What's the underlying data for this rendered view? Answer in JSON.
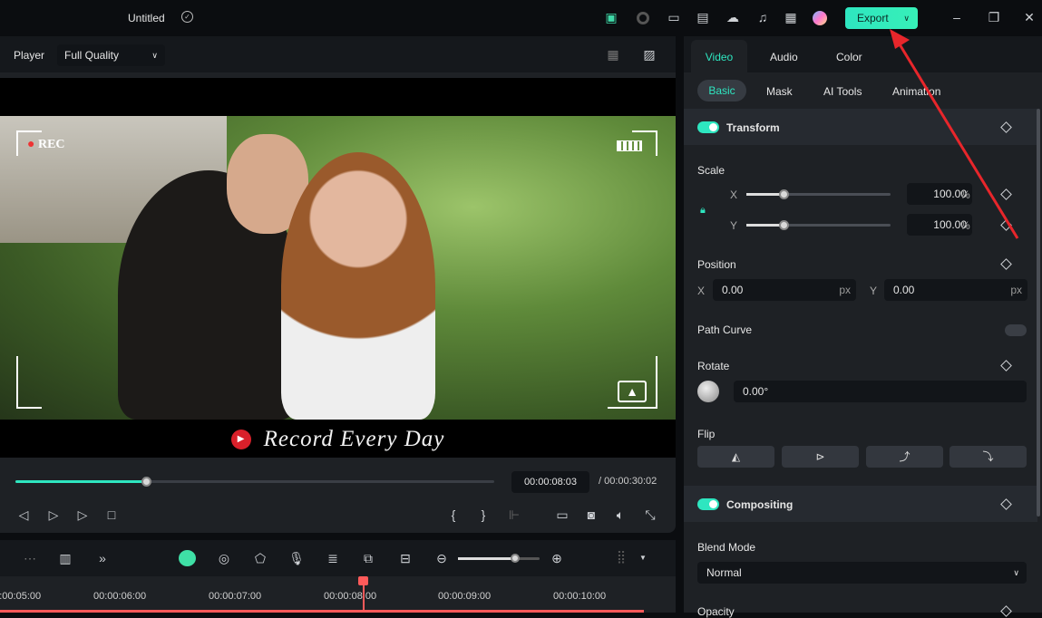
{
  "app": {
    "title": "Untitled",
    "export_label": "Export"
  },
  "topbar_icons": [
    "gift-icon",
    "record-icon",
    "layout-icon",
    "save-icon",
    "cloud-upload-icon",
    "headset-icon",
    "apps-grid-icon",
    "avatar",
    "minimize-icon",
    "restore-icon",
    "close-icon"
  ],
  "player": {
    "label": "Player",
    "quality": "Full Quality",
    "current_time": "00:00:08:03",
    "total_time": "00:00:30:02",
    "progress_percent": 26.5,
    "rec_label": "REC",
    "caption": "Record Every Day"
  },
  "timeline": {
    "ticks": [
      "00:00:05:00",
      "00:00:06:00",
      "00:00:07:00",
      "00:00:08:00",
      "00:00:09:00",
      "00:00:10:00"
    ],
    "zoom_percent": 75
  },
  "panel": {
    "tabs": [
      "Video",
      "Audio",
      "Color"
    ],
    "active_tab": "Video",
    "subtabs": [
      "Basic",
      "Mask",
      "AI Tools",
      "Animation"
    ],
    "active_subtab": "Basic",
    "transform": {
      "title": "Transform",
      "enabled": true,
      "scale": {
        "label": "Scale",
        "x_label": "X",
        "y_label": "Y",
        "x": "100.00",
        "y": "100.00",
        "unit": "%"
      },
      "position": {
        "label": "Position",
        "x_label": "X",
        "y_label": "Y",
        "x": "0.00",
        "y": "0.00",
        "unit": "px"
      },
      "path_curve": "Path Curve",
      "rotate": {
        "label": "Rotate",
        "value": "0.00°"
      },
      "flip": {
        "label": "Flip"
      }
    },
    "compositing": {
      "title": "Compositing",
      "enabled": true,
      "blend_label": "Blend Mode",
      "blend_value": "Normal",
      "opacity_label": "Opacity"
    }
  },
  "colors": {
    "accent": "#2ee6c0",
    "playhead": "#ff5a5a",
    "arrow": "#e8262b"
  }
}
